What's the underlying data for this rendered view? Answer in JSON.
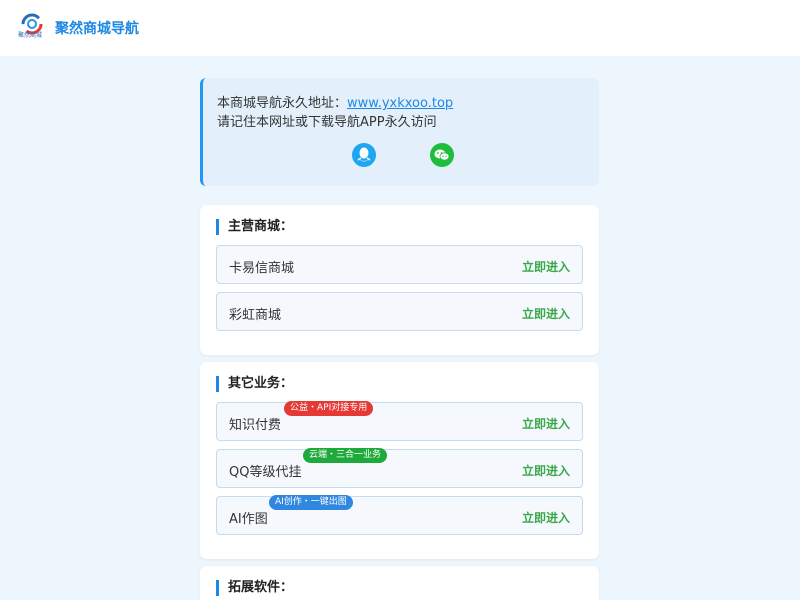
{
  "header": {
    "logo_text": "聚然商城",
    "title": "聚然商城导航"
  },
  "notice": {
    "line1_prefix": "本商城导航永久地址：",
    "url": "www.yxkxoo.top",
    "line2": "请记住本网址或下载导航APP永久访问",
    "icons": [
      "qq-icon",
      "wechat-icon"
    ]
  },
  "sections": [
    {
      "title": "主营商城：",
      "items": [
        {
          "label": "卡易信商城",
          "action": "立即进入"
        },
        {
          "label": "彩虹商城",
          "action": "立即进入"
        }
      ]
    },
    {
      "title": "其它业务：",
      "items": [
        {
          "label": "知识付费",
          "badge": "公益・API对接专用",
          "badge_color": "#e53935",
          "action": "立即进入"
        },
        {
          "label": "QQ等级代挂",
          "badge": "云端・三合一业务",
          "badge_color": "#1eaa3a",
          "action": "立即进入"
        },
        {
          "label": "AI作图",
          "badge": "AI创作・一键出图",
          "badge_color": "#2f87e0",
          "action": "立即进入"
        }
      ]
    },
    {
      "title": "拓展软件：",
      "items": []
    }
  ],
  "colors": {
    "accent": "#1e88e5",
    "go": "#3aa84a",
    "background": "#eef6fd"
  }
}
